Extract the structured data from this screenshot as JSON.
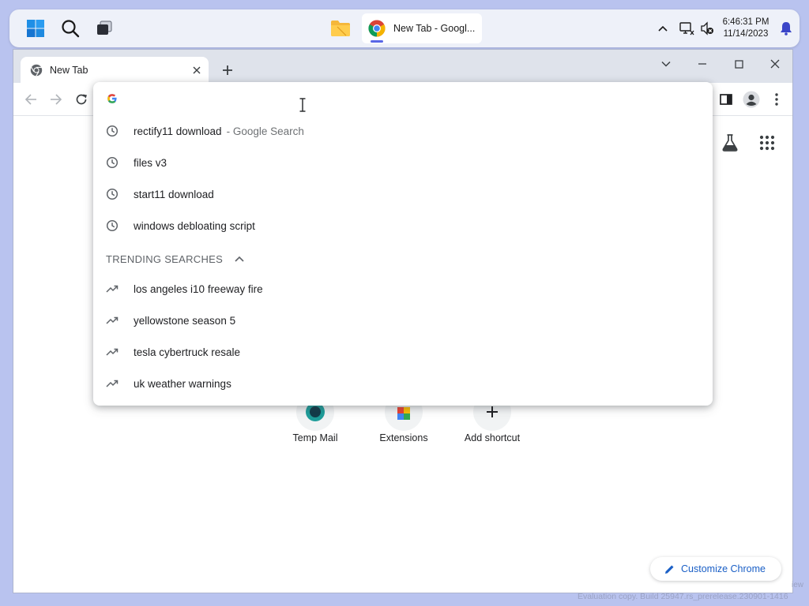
{
  "taskbar": {
    "app_label": "New Tab - Googl...",
    "time": "6:46:31 PM",
    "date": "11/14/2023",
    "accent_color": "#5866e6"
  },
  "browser": {
    "tab_title": "New Tab",
    "omnibox": {
      "value": "",
      "placeholder": ""
    },
    "history_suggestions": [
      {
        "text": "rectify11 download",
        "description": "- Google Search",
        "icon": "clock-icon"
      },
      {
        "text": "files v3",
        "description": "",
        "icon": "clock-icon"
      },
      {
        "text": "start11 download",
        "description": "",
        "icon": "clock-icon"
      },
      {
        "text": "windows debloating script",
        "description": "",
        "icon": "clock-icon"
      }
    ],
    "trending_header": "TRENDING SEARCHES",
    "trending": [
      {
        "text": "los angeles i10 freeway fire",
        "icon": "trending-up-icon"
      },
      {
        "text": "yellowstone season 5",
        "icon": "trending-up-icon"
      },
      {
        "text": "tesla cybertruck resale",
        "icon": "trending-up-icon"
      },
      {
        "text": "uk weather warnings",
        "icon": "trending-up-icon"
      }
    ],
    "shortcuts": [
      {
        "label": "Temp Mail"
      },
      {
        "label": "Extensions"
      },
      {
        "label": "Add shortcut"
      }
    ],
    "customize_label": "Customize Chrome",
    "link_color": "#1a5fc6"
  },
  "watermark": {
    "line1": "iew",
    "line2": "Evaluation copy. Build 25947.rs_prerelease.230901-1416"
  }
}
